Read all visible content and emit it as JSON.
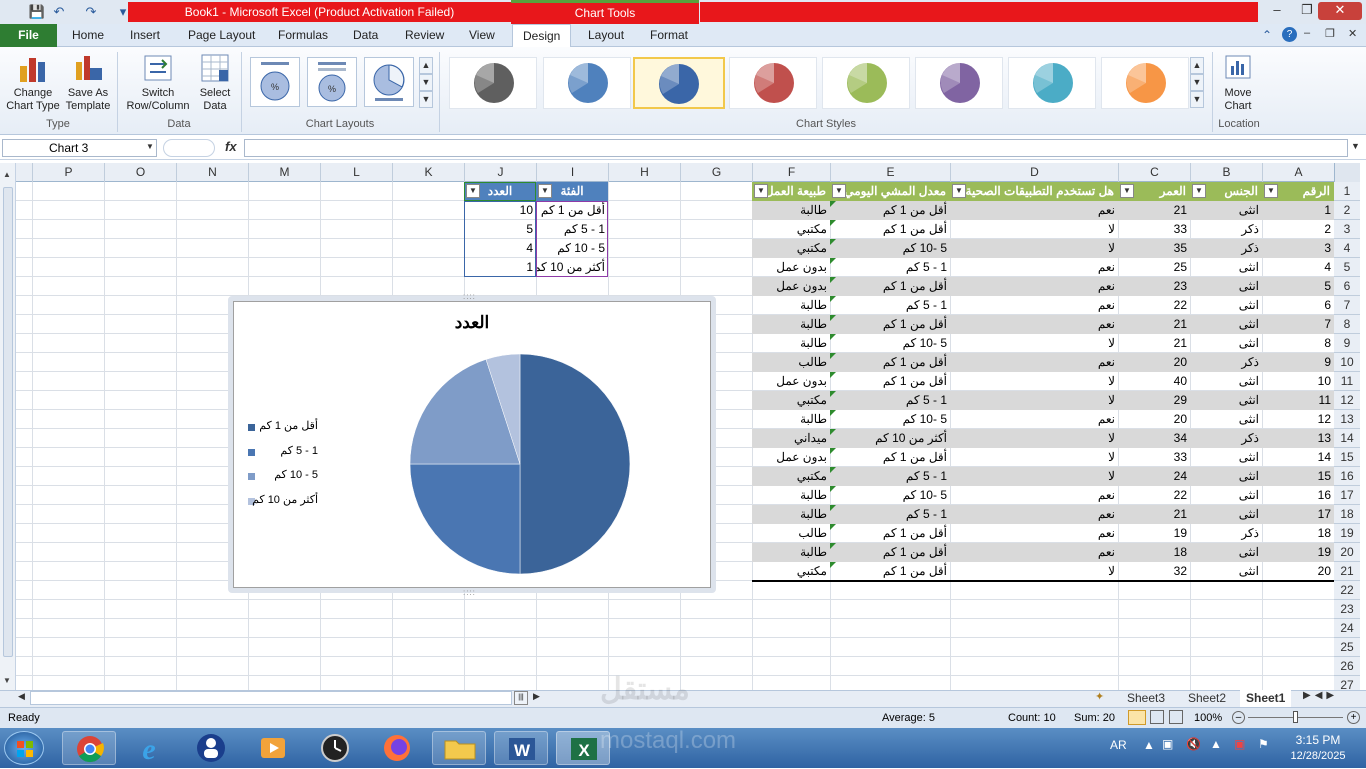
{
  "window": {
    "title": "Book1  -  Microsoft Excel (Product Activation Failed)",
    "context_tab": "Chart Tools"
  },
  "ribbon": {
    "tabs": [
      "File",
      "Home",
      "Insert",
      "Page Layout",
      "Formulas",
      "Data",
      "Review",
      "View",
      "Design",
      "Layout",
      "Format"
    ],
    "active_tab": "Design",
    "groups": {
      "type": {
        "label": "Type",
        "change_chart_type": "Change Chart Type",
        "save_as_template": "Save As Template"
      },
      "data": {
        "label": "Data",
        "switch_row_column": "Switch Row/Column",
        "select_data": "Select Data"
      },
      "layouts": {
        "label": "Chart Layouts"
      },
      "styles": {
        "label": "Chart Styles",
        "colors": [
          "#5f5f5f",
          "#4f81bd",
          "#3a66a8",
          "#c0504d",
          "#9bbb59",
          "#8064a2",
          "#4bacc6",
          "#f79646"
        ]
      },
      "location": {
        "label": "Location",
        "move_chart": "Move Chart"
      }
    }
  },
  "formula_bar": {
    "name_box": "Chart 3",
    "fx": "fx",
    "value": ""
  },
  "columns": [
    "P",
    "O",
    "N",
    "M",
    "L",
    "K",
    "J",
    "I",
    "H",
    "G",
    "F",
    "E",
    "D",
    "C",
    "B",
    "A"
  ],
  "rows": [
    "1",
    "2",
    "3",
    "4",
    "5",
    "6",
    "7",
    "8",
    "9",
    "10",
    "11",
    "12",
    "13",
    "14",
    "15",
    "16",
    "17",
    "18",
    "19",
    "20",
    "21",
    "22",
    "23",
    "24",
    "25",
    "26",
    "27"
  ],
  "table": {
    "headers": [
      "الرقم",
      "الجنس",
      "العمر",
      "هل تستخدم التطبيقات الصحية",
      "معدل المشي اليومي",
      "طبيعة العمل"
    ],
    "rows": [
      [
        "1",
        "انثى",
        "21",
        "نعم",
        "أقل من 1 كم",
        "طالبة"
      ],
      [
        "2",
        "ذكر",
        "33",
        "لا",
        "أقل من 1 كم",
        "مكتبي"
      ],
      [
        "3",
        "ذكر",
        "35",
        "لا",
        "5 -10 كم",
        "مكتبي"
      ],
      [
        "4",
        "انثى",
        "25",
        "نعم",
        "1 - 5 كم",
        "بدون عمل"
      ],
      [
        "5",
        "انثى",
        "23",
        "نعم",
        "أقل من 1 كم",
        "بدون عمل"
      ],
      [
        "6",
        "انثى",
        "22",
        "نعم",
        "1 - 5 كم",
        "طالبة"
      ],
      [
        "7",
        "انثى",
        "21",
        "نعم",
        "أقل من 1 كم",
        "طالبة"
      ],
      [
        "8",
        "انثى",
        "21",
        "لا",
        "5 -10 كم",
        "طالبة"
      ],
      [
        "9",
        "ذكر",
        "20",
        "نعم",
        "أقل من 1 كم",
        "طالب"
      ],
      [
        "10",
        "انثى",
        "40",
        "لا",
        "أقل من 1 كم",
        "بدون عمل"
      ],
      [
        "11",
        "انثى",
        "29",
        "لا",
        "1 - 5 كم",
        "مكتبي"
      ],
      [
        "12",
        "انثى",
        "20",
        "نعم",
        "5 -10 كم",
        "طالبة"
      ],
      [
        "13",
        "ذكر",
        "34",
        "لا",
        "أكثر من 10 كم",
        "ميداني"
      ],
      [
        "14",
        "انثى",
        "33",
        "لا",
        "أقل من 1 كم",
        "بدون عمل"
      ],
      [
        "15",
        "انثى",
        "24",
        "لا",
        "1 - 5 كم",
        "مكتبي"
      ],
      [
        "16",
        "انثى",
        "22",
        "نعم",
        "5 -10 كم",
        "طالبة"
      ],
      [
        "17",
        "انثى",
        "21",
        "نعم",
        "1 - 5 كم",
        "طالبة"
      ],
      [
        "18",
        "ذكر",
        "19",
        "نعم",
        "أقل من 1 كم",
        "طالب"
      ],
      [
        "19",
        "انثى",
        "18",
        "نعم",
        "أقل من 1 كم",
        "طالبة"
      ],
      [
        "20",
        "انثى",
        "32",
        "لا",
        "أقل من 1 كم",
        "مكتبي"
      ]
    ]
  },
  "pivot": {
    "headers": [
      "الفئة",
      "العدد"
    ],
    "rows": [
      [
        "أقل من 1 كم",
        "10"
      ],
      [
        "1 - 5 كم",
        "5"
      ],
      [
        "5 - 10 كم",
        "4"
      ],
      [
        "أكثر من 10 كم",
        "1"
      ]
    ]
  },
  "chart_data": {
    "type": "pie",
    "title": "العدد",
    "categories": [
      "أقل من 1 كم",
      "1 - 5 كم",
      "5 - 10 كم",
      "أكثر من 10 كم"
    ],
    "values": [
      10,
      5,
      4,
      1
    ],
    "colors": [
      "#3b6499",
      "#4a76b2",
      "#7f9cc8",
      "#b3c2de"
    ],
    "legend_position": "left"
  },
  "sheets": {
    "tabs": [
      "Sheet3",
      "Sheet2",
      "Sheet1"
    ],
    "active": "Sheet1"
  },
  "status": {
    "ready": "Ready",
    "average": "Average: 5",
    "count": "Count: 10",
    "sum": "Sum: 20",
    "zoom": "100%"
  },
  "taskbar": {
    "lang": "AR",
    "time": "3:15 PM",
    "date": "12/28/2025"
  },
  "watermark": {
    "line1": "مستقل",
    "line2": "mostaql.com"
  }
}
